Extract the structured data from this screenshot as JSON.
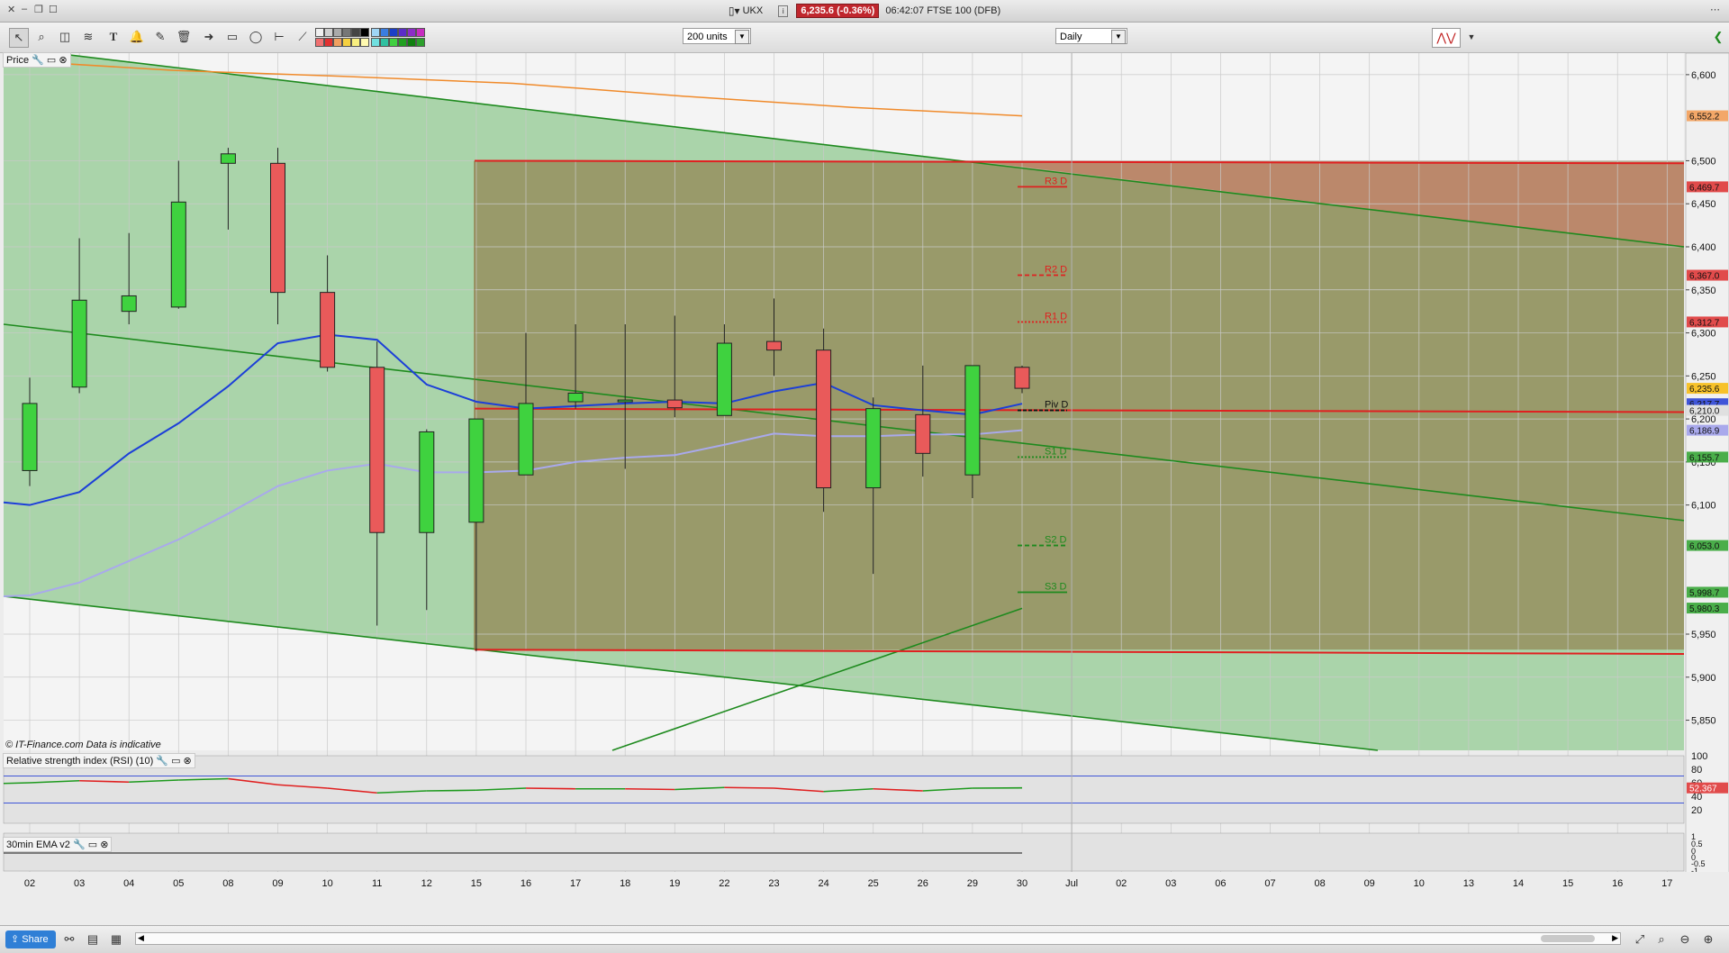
{
  "window": {
    "symbol": "UKX",
    "price_badge": "6,235.6 (-0.36%)",
    "title_rest": "06:42:07 FTSE 100 (DFB)"
  },
  "toolbar": {
    "units_select": "200 units",
    "interval_select": "Daily"
  },
  "panels": {
    "price_label": "Price",
    "copyright": "© IT-Finance.com  Data is indicative",
    "rsi_label": "Relative strength index (RSI) (10)",
    "ema_label": "30min EMA v2"
  },
  "price_axis": {
    "ticks": [
      "6,600",
      "6,500",
      "6,450",
      "6,400",
      "6,350",
      "6,300",
      "6,250",
      "6,200",
      "6,150",
      "6,100",
      "5,950",
      "5,900",
      "5,850"
    ],
    "tags": [
      {
        "text": "6,552.2",
        "bg": "#f3a768"
      },
      {
        "text": "6,469.7",
        "bg": "#e14b4b"
      },
      {
        "text": "6,367.0",
        "bg": "#e14b4b"
      },
      {
        "text": "6,312.7",
        "bg": "#e14b4b"
      },
      {
        "text": "6,235.6",
        "bg": "#f7c22a"
      },
      {
        "text": "6,217.7",
        "bg": "#3f55d8"
      },
      {
        "text": "6,210.0",
        "bg": "#e0e0e0"
      },
      {
        "text": "6,186.9",
        "bg": "#a9a9ec"
      },
      {
        "text": "6,155.7",
        "bg": "#4aae4a"
      },
      {
        "text": "6,053.0",
        "bg": "#4aae4a"
      },
      {
        "text": "5,998.7",
        "bg": "#4aae4a"
      },
      {
        "text": "5,980.3",
        "bg": "#4aae4a"
      }
    ]
  },
  "pivots": [
    "R3 D",
    "R2 D",
    "R1 D",
    "Piv D",
    "S1 D",
    "S2 D",
    "S3 D"
  ],
  "rsi_axis": {
    "ticks": [
      "100",
      "80",
      "60",
      "40",
      "20"
    ],
    "tag": "52.367"
  },
  "ema_axis": {
    "ticks": [
      "1",
      "0.5",
      "0",
      "0",
      "-0.5",
      "-1"
    ]
  },
  "date_axis": [
    "02",
    "03",
    "04",
    "05",
    "08",
    "09",
    "10",
    "11",
    "12",
    "15",
    "16",
    "17",
    "18",
    "19",
    "22",
    "23",
    "24",
    "25",
    "26",
    "29",
    "30",
    "Jul",
    "02",
    "03",
    "06",
    "07",
    "08",
    "09",
    "10",
    "13",
    "14",
    "15",
    "16",
    "17"
  ],
  "status": {
    "share_label": "Share"
  },
  "chart_data": {
    "type": "candlestick",
    "title": "FTSE 100 (DFB)",
    "interval": "Daily",
    "categories": [
      "02",
      "03",
      "04",
      "05",
      "08",
      "09",
      "10",
      "11",
      "12",
      "15",
      "16",
      "17",
      "18",
      "19",
      "22",
      "23",
      "24",
      "25",
      "26",
      "29",
      "30"
    ],
    "open": [
      6140,
      6237,
      6325,
      6330,
      6497,
      6497,
      6347,
      6260,
      6068,
      6080,
      6135,
      6220,
      6222,
      6222,
      6204,
      6290,
      6280,
      6120,
      6205,
      6135,
      6260
    ],
    "high": [
      6248,
      6410,
      6416,
      6500,
      6515,
      6515,
      6390,
      6290,
      6188,
      6160,
      6300,
      6310,
      6310,
      6320,
      6310,
      6340,
      6305,
      6225,
      6262,
      6262,
      6262
    ],
    "low": [
      6122,
      6230,
      6310,
      6328,
      6420,
      6310,
      6255,
      5960,
      5978,
      5930,
      6135,
      6212,
      6142,
      6202,
      6210,
      6250,
      6092,
      6020,
      6133,
      6108,
      6230
    ],
    "close": [
      6218,
      6338,
      6343,
      6452,
      6508,
      6347,
      6260,
      6068,
      6185,
      6200,
      6218,
      6230,
      6222,
      6213,
      6288,
      6280,
      6120,
      6212,
      6160,
      6262,
      6235.6
    ],
    "overlays": {
      "sma_fast_blue": [
        6100,
        6115,
        6160,
        6195,
        6238,
        6288,
        6298,
        6292,
        6240,
        6220,
        6212,
        6215,
        6218,
        6220,
        6218,
        6232,
        6242,
        6216,
        6210,
        6205,
        6217.7
      ],
      "sma_slow_lavender": [
        5995,
        6010,
        6035,
        6060,
        6090,
        6122,
        6140,
        6148,
        6138,
        6138,
        6140,
        6150,
        6155,
        6158,
        6170,
        6183,
        6180,
        6180,
        6182,
        6182,
        6186.9
      ],
      "sma_orange": [
        6617,
        6605,
        6598,
        6590,
        6575,
        6562,
        6552.2
      ]
    },
    "pivots": {
      "R3 D": 6469.7,
      "R2 D": 6367.0,
      "R1 D": 6312.7,
      "Piv D": 6210.0,
      "S1 D": 6155.7,
      "S2 D": 6053.0,
      "S3 D": 5998.7
    },
    "rsi": {
      "period": 10,
      "last": 52.367,
      "values": [
        60,
        63,
        61,
        64,
        66,
        57,
        52,
        45,
        48,
        49,
        52,
        51,
        51,
        50,
        53,
        52,
        47,
        51,
        48,
        52,
        52.367
      ],
      "bands": [
        70,
        30
      ]
    },
    "y_range": [
      5815,
      6625
    ]
  }
}
